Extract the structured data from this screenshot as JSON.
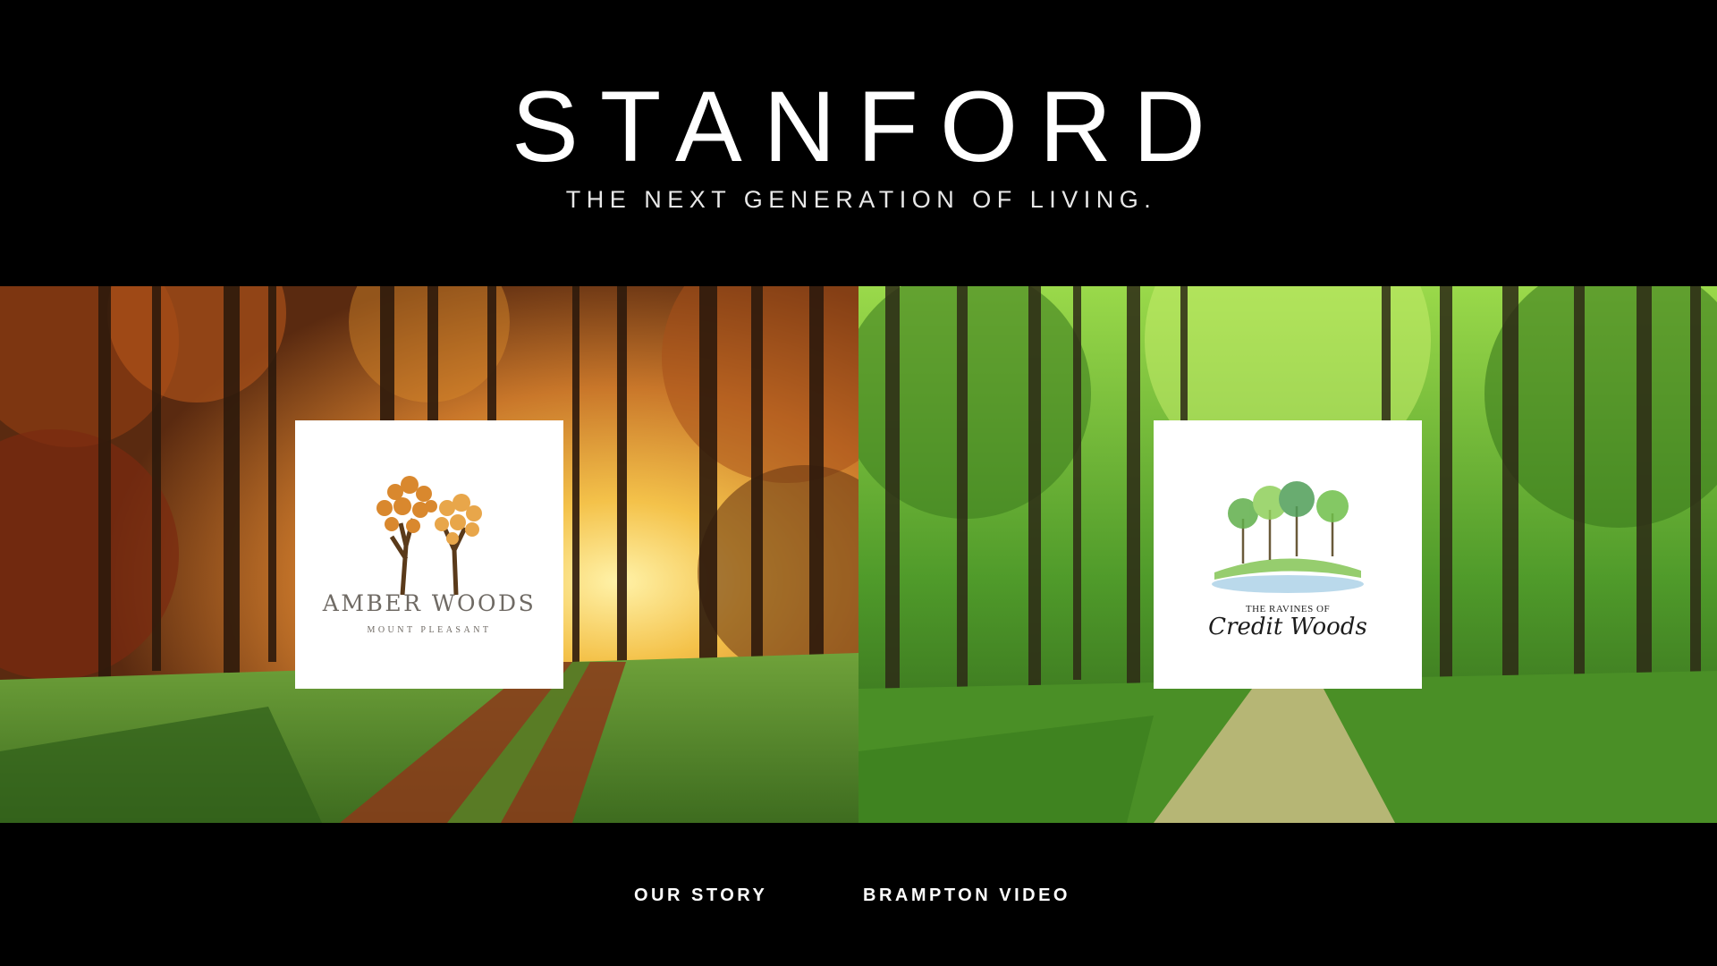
{
  "brand": {
    "name": "STANFORD",
    "tagline": "THE NEXT GENERATION OF LIVING."
  },
  "communities": [
    {
      "title": "AMBER WOODS",
      "subtitle": "MOUNT PLEASANT",
      "icon": "amber-trees-icon",
      "scene": "autumn-forest-path"
    },
    {
      "title_small": "THE RAVINES OF",
      "title_main": "Credit Woods",
      "icon": "watercolor-trees-icon",
      "scene": "green-forest-path"
    }
  ],
  "nav": {
    "our_story": "OUR STORY",
    "brampton_video": "BRAMPTON VIDEO"
  },
  "colors": {
    "background": "#000000",
    "text": "#ffffff",
    "amber": "#c9802c",
    "forest_green": "#4f9a2a"
  }
}
